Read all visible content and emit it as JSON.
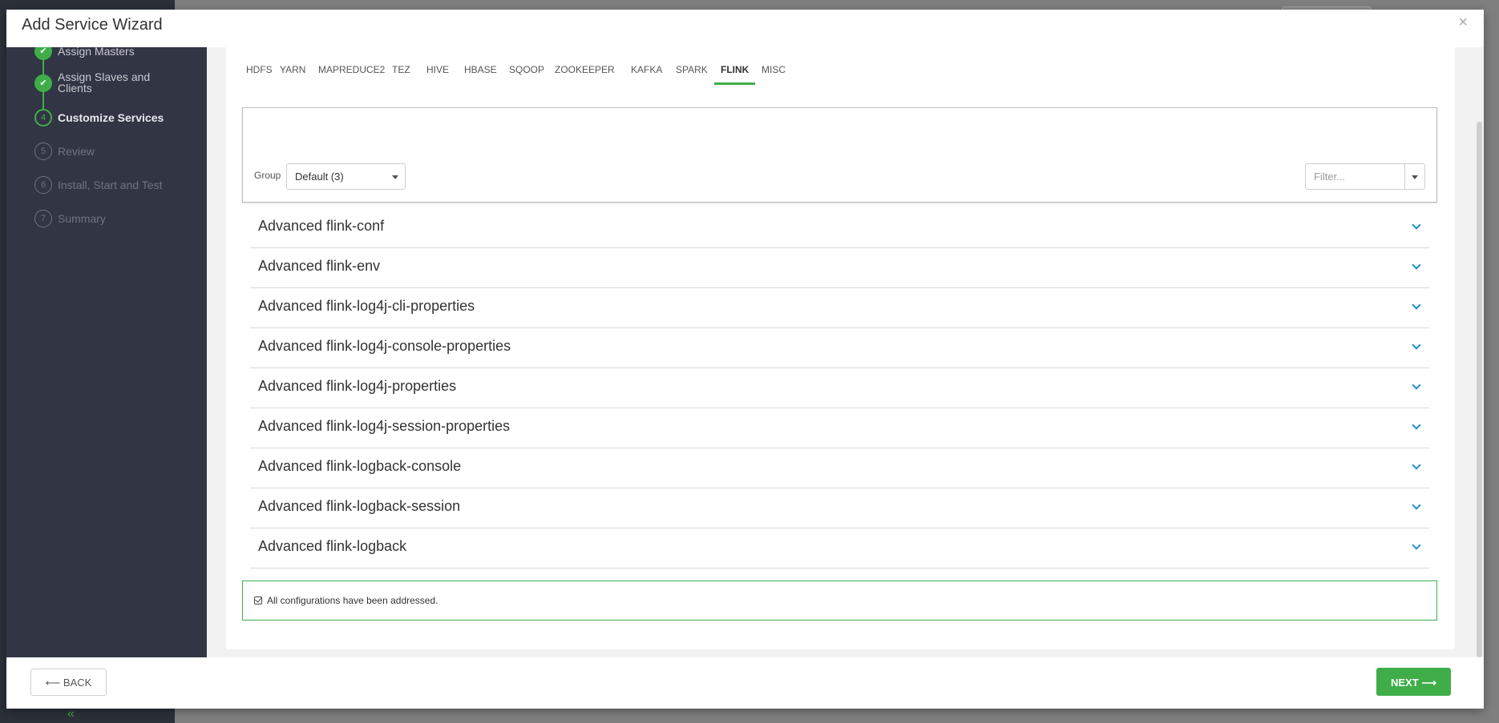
{
  "modal": {
    "title": "Add Service Wizard",
    "close_glyph": "×"
  },
  "wizard_steps": [
    {
      "number": "",
      "label": "Assign Masters",
      "state": "done"
    },
    {
      "number": "",
      "label": "Assign Slaves and Clients",
      "label_line1": "Assign Slaves and",
      "label_line2": "Clients",
      "state": "done"
    },
    {
      "number": "4",
      "label": "Customize Services",
      "state": "active"
    },
    {
      "number": "5",
      "label": "Review",
      "state": "pending"
    },
    {
      "number": "6",
      "label": "Install, Start and Test",
      "state": "pending"
    },
    {
      "number": "7",
      "label": "Summary",
      "state": "pending"
    }
  ],
  "tabs": [
    {
      "label": "HDFS"
    },
    {
      "label": "YARN"
    },
    {
      "label": "MAPREDUCE2"
    },
    {
      "label": "TEZ"
    },
    {
      "label": "HIVE"
    },
    {
      "label": "HBASE"
    },
    {
      "label": "SQOOP"
    },
    {
      "label": "ZOOKEEPER"
    },
    {
      "label": "KAFKA"
    },
    {
      "label": "SPARK"
    },
    {
      "label": "FLINK",
      "active": true
    },
    {
      "label": "MISC"
    }
  ],
  "filters": {
    "group_label": "Group",
    "group_value": "Default (3)",
    "filter_placeholder": "Filter..."
  },
  "sections": [
    {
      "title": "Advanced flink-conf"
    },
    {
      "title": "Advanced flink-env"
    },
    {
      "title": "Advanced flink-log4j-cli-properties"
    },
    {
      "title": "Advanced flink-log4j-console-properties"
    },
    {
      "title": "Advanced flink-log4j-properties"
    },
    {
      "title": "Advanced flink-log4j-session-properties"
    },
    {
      "title": "Advanced flink-logback-console"
    },
    {
      "title": "Advanced flink-logback-session"
    },
    {
      "title": "Advanced flink-logback"
    }
  ],
  "alert": {
    "text": "All configurations have been addressed."
  },
  "footer": {
    "back_label": "⟵ BACK",
    "next_label": "NEXT ⟶"
  },
  "background": {
    "collapse_glyph": "«"
  },
  "colors": {
    "accent_green": "#3fae49",
    "nav_background": "#323544",
    "chevron_blue": "#1a8fd0"
  }
}
